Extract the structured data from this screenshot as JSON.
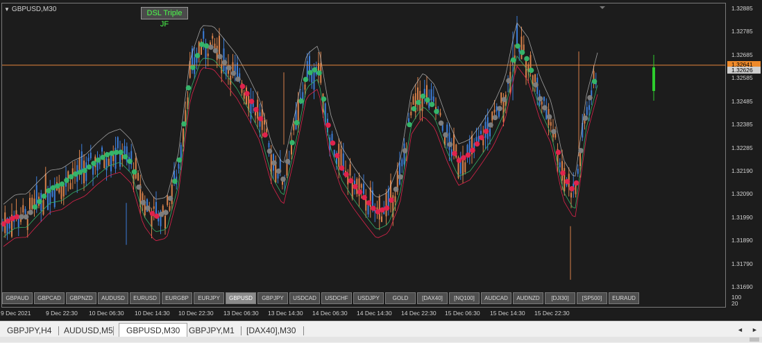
{
  "window": {
    "symbol_timeframe": "GBPUSD,M30"
  },
  "indicator": {
    "label": "DSL Triple JF"
  },
  "chart_data": {
    "type": "candlestick",
    "symbol": "GBPUSD",
    "timeframe": "M30",
    "ylim": [
      1.3164,
      1.3293
    ],
    "price_ticks": [
      "1.32885",
      "1.32785",
      "1.32685",
      "1.32585",
      "1.32485",
      "1.32385",
      "1.32285",
      "1.32190",
      "1.32090",
      "1.31990",
      "1.31890",
      "1.31790",
      "1.31690"
    ],
    "time_ticks": [
      "9 Dec 2021",
      "9 Dec 22:30",
      "10 Dec 06:30",
      "10 Dec 14:30",
      "10 Dec 22:30",
      "13 Dec 06:30",
      "13 Dec 14:30",
      "14 Dec 06:30",
      "14 Dec 14:30",
      "14 Dec 22:30",
      "15 Dec 06:30",
      "15 Dec 14:30",
      "15 Dec 22:30"
    ],
    "bid_line": "1.32641",
    "current_price": "1.32626",
    "indicator_scale": [
      "100",
      "20"
    ],
    "colors": {
      "bull": "#3b7dd8",
      "bear": "#d9814a",
      "dsl_up": "#35b46a",
      "dsl_flat": "#7d7d7d",
      "dsl_down": "#e0234c",
      "bid_line": "#e8863b",
      "bid_tag": "#ef8a2a",
      "price_tag": "#cfcfcf",
      "volume_bar": "#2dcc2d"
    },
    "dsl_track": [
      1.3196,
      1.3199,
      1.3199,
      1.3205,
      1.3211,
      1.3213,
      1.3217,
      1.3219,
      1.3223,
      1.3226,
      1.3227,
      1.3222,
      1.3205,
      1.3199,
      1.3201,
      1.322,
      1.326,
      1.3273,
      1.32715,
      1.3265,
      1.3259,
      1.3251,
      1.3242,
      1.3224,
      1.3215,
      1.3236,
      1.326,
      1.3263,
      1.3234,
      1.322,
      1.3213,
      1.3207,
      1.3201,
      1.3203,
      1.3215,
      1.3244,
      1.3251,
      1.3246,
      1.3233,
      1.3223,
      1.3226,
      1.3233,
      1.324,
      1.325,
      1.3273,
      1.3266,
      1.325,
      1.324,
      1.3217,
      1.3209,
      1.3245,
      1.3263
    ],
    "dsl_colors": [
      "down",
      "down",
      "flat",
      "up",
      "up",
      "up",
      "up",
      "up",
      "up",
      "up",
      "up",
      "up",
      "flat",
      "down",
      "flat",
      "up",
      "up",
      "up",
      "flat",
      "flat",
      "flat",
      "down",
      "down",
      "flat",
      "flat",
      "up",
      "up",
      "up",
      "down",
      "down",
      "down",
      "down",
      "down",
      "down",
      "flat",
      "up",
      "up",
      "up",
      "flat",
      "down",
      "down",
      "down",
      "flat",
      "flat",
      "up",
      "up",
      "flat",
      "flat",
      "down",
      "down",
      "flat",
      "up"
    ]
  },
  "symbol_bar": [
    {
      "label": "GBPAUD"
    },
    {
      "label": "GBPCAD"
    },
    {
      "label": "GBPNZD"
    },
    {
      "label": "AUDUSD"
    },
    {
      "label": "EURUSD"
    },
    {
      "label": "EURGBP"
    },
    {
      "label": "EURJPY"
    },
    {
      "label": "GBPUSD",
      "active": true
    },
    {
      "label": "GBPJPY"
    },
    {
      "label": "USDCAD"
    },
    {
      "label": "USDCHF"
    },
    {
      "label": "USDJPY"
    },
    {
      "label": "GOLD"
    },
    {
      "label": "[DAX40]"
    },
    {
      "label": "[NQ100]"
    },
    {
      "label": "AUDCAD"
    },
    {
      "label": "AUDNZD"
    },
    {
      "label": "[DJI30]"
    },
    {
      "label": "[SP500]"
    },
    {
      "label": "EURAUD"
    }
  ],
  "tabs": [
    {
      "label": "GBPJPY,H4"
    },
    {
      "label": "AUDUSD,M5"
    },
    {
      "label": "GBPUSD,M30",
      "active": true
    },
    {
      "label": "GBPJPY,M1"
    },
    {
      "label": "[DAX40],M30"
    }
  ],
  "nav": {
    "prev_icon": "◄",
    "next_icon": "►"
  }
}
